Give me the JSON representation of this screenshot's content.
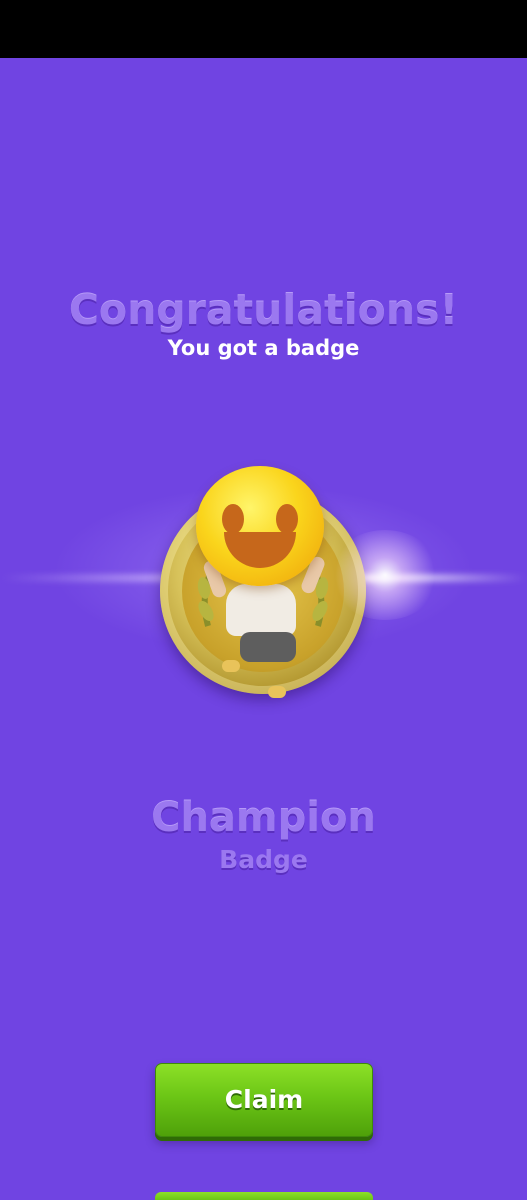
{
  "header": {
    "title": "Congratulations!",
    "subtitle": "You got a badge"
  },
  "badge": {
    "name": "Champion",
    "type": "Badge",
    "icon": "champion-badge-icon"
  },
  "actions": {
    "claim_label": "Claim"
  },
  "colors": {
    "background": "#7044e2",
    "title_text": "#9b78f0",
    "button_green": "#6cc616"
  }
}
